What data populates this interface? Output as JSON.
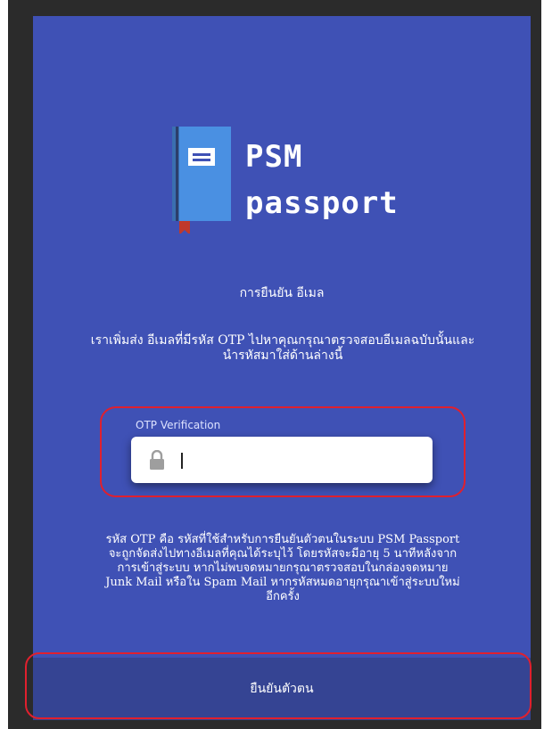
{
  "brand": {
    "line1": "PSM",
    "line2": "passport"
  },
  "screen": {
    "title": "การยืนยัน อีเมล",
    "instructions": "เราเพิ่มส่ง อีเมลที่มีรหัส OTP ไปหาคุณกรุณาตรวจสอบอีเมลฉบับนั้นและนำรหัสมาใส่ด้านล่างนี้"
  },
  "otp": {
    "label": "OTP Verification",
    "value": "",
    "lock_icon": "lock-icon"
  },
  "note": "รหัส OTP คือ รหัสที่ใช้สำหรับการยืนยันตัวตนในระบบ PSM Passport จะถูกจัดส่งไปทางอีเมลที่คุณได้ระบุไว้ โดยรหัสจะมีอายุ 5 นาทีหลังจากการเข้าสู่ระบบ หากไม่พบจดหมายกรุณาตรวจสอบในกล่องจดหมาย Junk Mail หรือใน Spam Mail หากรหัสหมดอายุกรุณาเข้าสู่ระบบใหม่อีกครั้ง",
  "verify_button": "ยืนยันตัวตน",
  "colors": {
    "card": "#3f51b5",
    "button": "#354493",
    "highlight": "#e0202e",
    "book": "#4a90e2"
  }
}
